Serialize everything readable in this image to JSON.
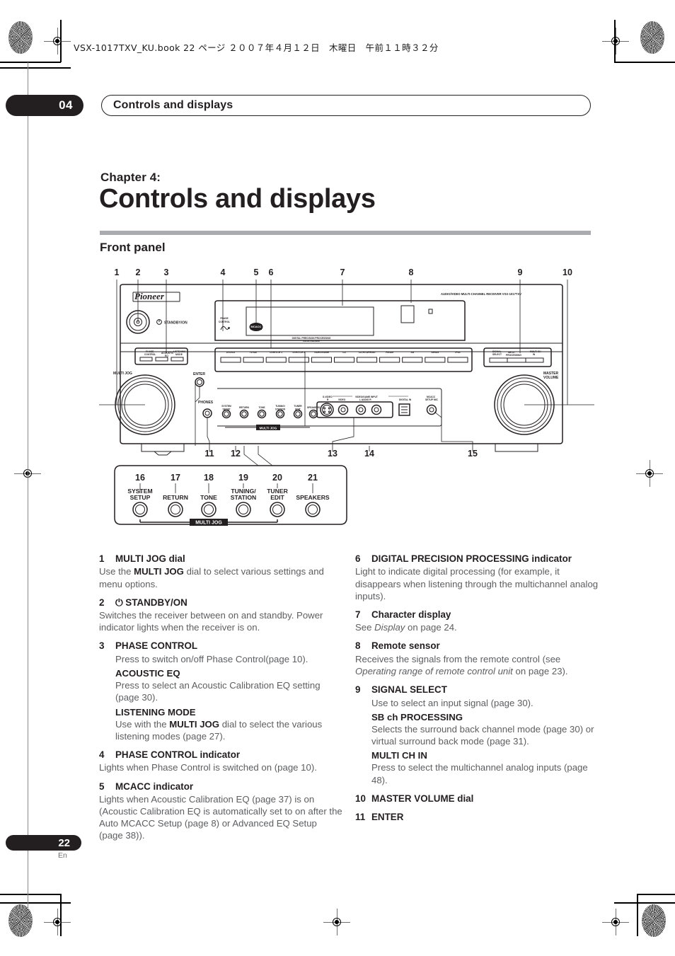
{
  "page": {
    "filestamp": "VSX-1017TXV_KU.book 22 ページ ２００７年４月１２日　木曜日　午前１１時３２分",
    "chapter_number": "04",
    "running_head": "Controls and displays",
    "chapter_label": "Chapter 4:",
    "chapter_title": "Controls and displays",
    "section_title": "Front panel",
    "page_number": "22",
    "page_language": "En"
  },
  "figure": {
    "name": "front-panel-diagram",
    "brand": "Pioneer",
    "model_text": "AUDIO/VIDEO MULTI-CHANNEL RECEIVER   VSX-1017TXV",
    "standby_label": "STANDBY/ON",
    "phase_control_label": "PHASE CONTROL",
    "dpp_label": "DIGITAL PRECISION PROCESSING",
    "multi_jog_label": "MULTI JOG",
    "master_volume_label": "MASTER VOLUME",
    "enter_label": "ENTER",
    "phones_label": "PHONES",
    "left_button_labels": [
      "PHASE CONTROL",
      "ACOUSTIC EQ",
      "LISTENING MODE"
    ],
    "right_button_labels": [
      "SIGNAL SELECT",
      "SB ch PROCESSING",
      "MULTI CH IN"
    ],
    "input_labels": [
      "DVD/LD",
      "TV/SAT",
      "DVR/VCR 1",
      "DVR/VCR 2",
      "VIDEO/GAME",
      "CD",
      "CD-R/TAPE/MD",
      "FM/AM",
      "XM",
      "SIRIUS",
      "iPod"
    ],
    "jack_group_label": "VIDEO/GAME INPUT",
    "jack_labels": [
      "S-VIDEO",
      "VIDEO",
      "L   AUDIO   R",
      "DIGITAL IN"
    ],
    "mcacc_jack_label": "MCACC SETUP MIC",
    "multi_jog_bracket_label": "MULTI JOG",
    "callouts_top": [
      "1",
      "2",
      "3",
      "4",
      "5",
      "6",
      "7",
      "8",
      "9",
      "10"
    ],
    "callouts_bottom": [
      "11",
      "12",
      "13",
      "14",
      "15"
    ],
    "callouts_inset": [
      "16",
      "17",
      "18",
      "19",
      "20",
      "21"
    ],
    "inset_button_labels": [
      [
        "SYSTEM",
        "SETUP"
      ],
      [
        "RETURN",
        ""
      ],
      [
        "TONE",
        ""
      ],
      [
        "TUNING/",
        "STATION"
      ],
      [
        "TUNER",
        "EDIT"
      ],
      [
        "SPEAKERS",
        ""
      ]
    ]
  },
  "left_column": [
    {
      "num": "1",
      "title": "MULTI JOG dial",
      "blocks": [
        {
          "kind": "para",
          "indent": false,
          "runs": [
            {
              "t": "Use the ",
              "b": false
            },
            {
              "t": "MULTI JOG",
              "b": true
            },
            {
              "t": " dial to select various settings and menu options.",
              "b": false
            }
          ]
        }
      ]
    },
    {
      "num": "2",
      "title": "⏻ STANDBY/ON",
      "blocks": [
        {
          "kind": "para",
          "indent": false,
          "runs": [
            {
              "t": "Switches the receiver between on and standby. Power indicator lights when the receiver is on.",
              "b": false
            }
          ]
        }
      ]
    },
    {
      "num": "3",
      "title": "PHASE CONTROL",
      "blocks": [
        {
          "kind": "para",
          "indent": true,
          "runs": [
            {
              "t": "Press to switch on/off Phase Control(page 10).",
              "b": false
            }
          ]
        },
        {
          "kind": "subhead",
          "text": "ACOUSTIC EQ"
        },
        {
          "kind": "para",
          "indent": true,
          "runs": [
            {
              "t": "Press to select an Acoustic Calibration EQ setting (page 30).",
              "b": false
            }
          ]
        },
        {
          "kind": "subhead",
          "text": "LISTENING MODE"
        },
        {
          "kind": "para",
          "indent": true,
          "runs": [
            {
              "t": "Use with the ",
              "b": false
            },
            {
              "t": "MULTI JOG",
              "b": true
            },
            {
              "t": " dial to select the various listening modes (page 27).",
              "b": false
            }
          ]
        }
      ]
    },
    {
      "num": "4",
      "title": "PHASE CONTROL indicator",
      "blocks": [
        {
          "kind": "para",
          "indent": false,
          "runs": [
            {
              "t": "Lights when Phase Control is switched on (page 10).",
              "b": false
            }
          ]
        }
      ]
    },
    {
      "num": "5",
      "title": "MCACC indicator",
      "blocks": [
        {
          "kind": "para",
          "indent": false,
          "runs": [
            {
              "t": "Lights when Acoustic Calibration EQ (page 37) is on (Acoustic Calibration EQ is automatically set to on after the Auto MCACC Setup (page 8) or Advanced EQ Setup (page 38)).",
              "b": false
            }
          ]
        }
      ]
    }
  ],
  "right_column": [
    {
      "num": "6",
      "title": "DIGITAL PRECISION PROCESSING indicator",
      "blocks": [
        {
          "kind": "para",
          "indent": false,
          "runs": [
            {
              "t": "Light to indicate digital processing (for example, it disappears when listening through the multichannel analog inputs).",
              "b": false
            }
          ]
        }
      ]
    },
    {
      "num": "7",
      "title": "Character display",
      "blocks": [
        {
          "kind": "para",
          "indent": false,
          "runs": [
            {
              "t": "See ",
              "b": false
            },
            {
              "t": "Display",
              "b": false,
              "i": true
            },
            {
              "t": " on page 24.",
              "b": false
            }
          ]
        }
      ]
    },
    {
      "num": "8",
      "title": "Remote sensor",
      "blocks": [
        {
          "kind": "para",
          "indent": false,
          "runs": [
            {
              "t": "Receives the signals from the remote control (see ",
              "b": false
            },
            {
              "t": "Operating range of remote control unit",
              "b": false,
              "i": true
            },
            {
              "t": " on page 23).",
              "b": false
            }
          ]
        }
      ]
    },
    {
      "num": "9",
      "title": "SIGNAL SELECT",
      "blocks": [
        {
          "kind": "para",
          "indent": true,
          "runs": [
            {
              "t": "Use to select an input signal (page 30).",
              "b": false
            }
          ]
        },
        {
          "kind": "subhead",
          "text": "SB ch PROCESSING"
        },
        {
          "kind": "para",
          "indent": true,
          "runs": [
            {
              "t": "Selects the surround back channel mode (page 30) or virtual surround back mode (page 31).",
              "b": false
            }
          ]
        },
        {
          "kind": "subhead",
          "text": "MULTI CH IN"
        },
        {
          "kind": "para",
          "indent": true,
          "runs": [
            {
              "t": "Press to select the multichannel analog inputs (page 48).",
              "b": false
            }
          ]
        }
      ]
    },
    {
      "num": "10",
      "title": "MASTER VOLUME dial",
      "blocks": []
    },
    {
      "num": "11",
      "title": "ENTER",
      "blocks": []
    }
  ],
  "colors": {
    "ink": "#231f20",
    "body_text": "#5d5e60",
    "rule": "#a9abae"
  }
}
